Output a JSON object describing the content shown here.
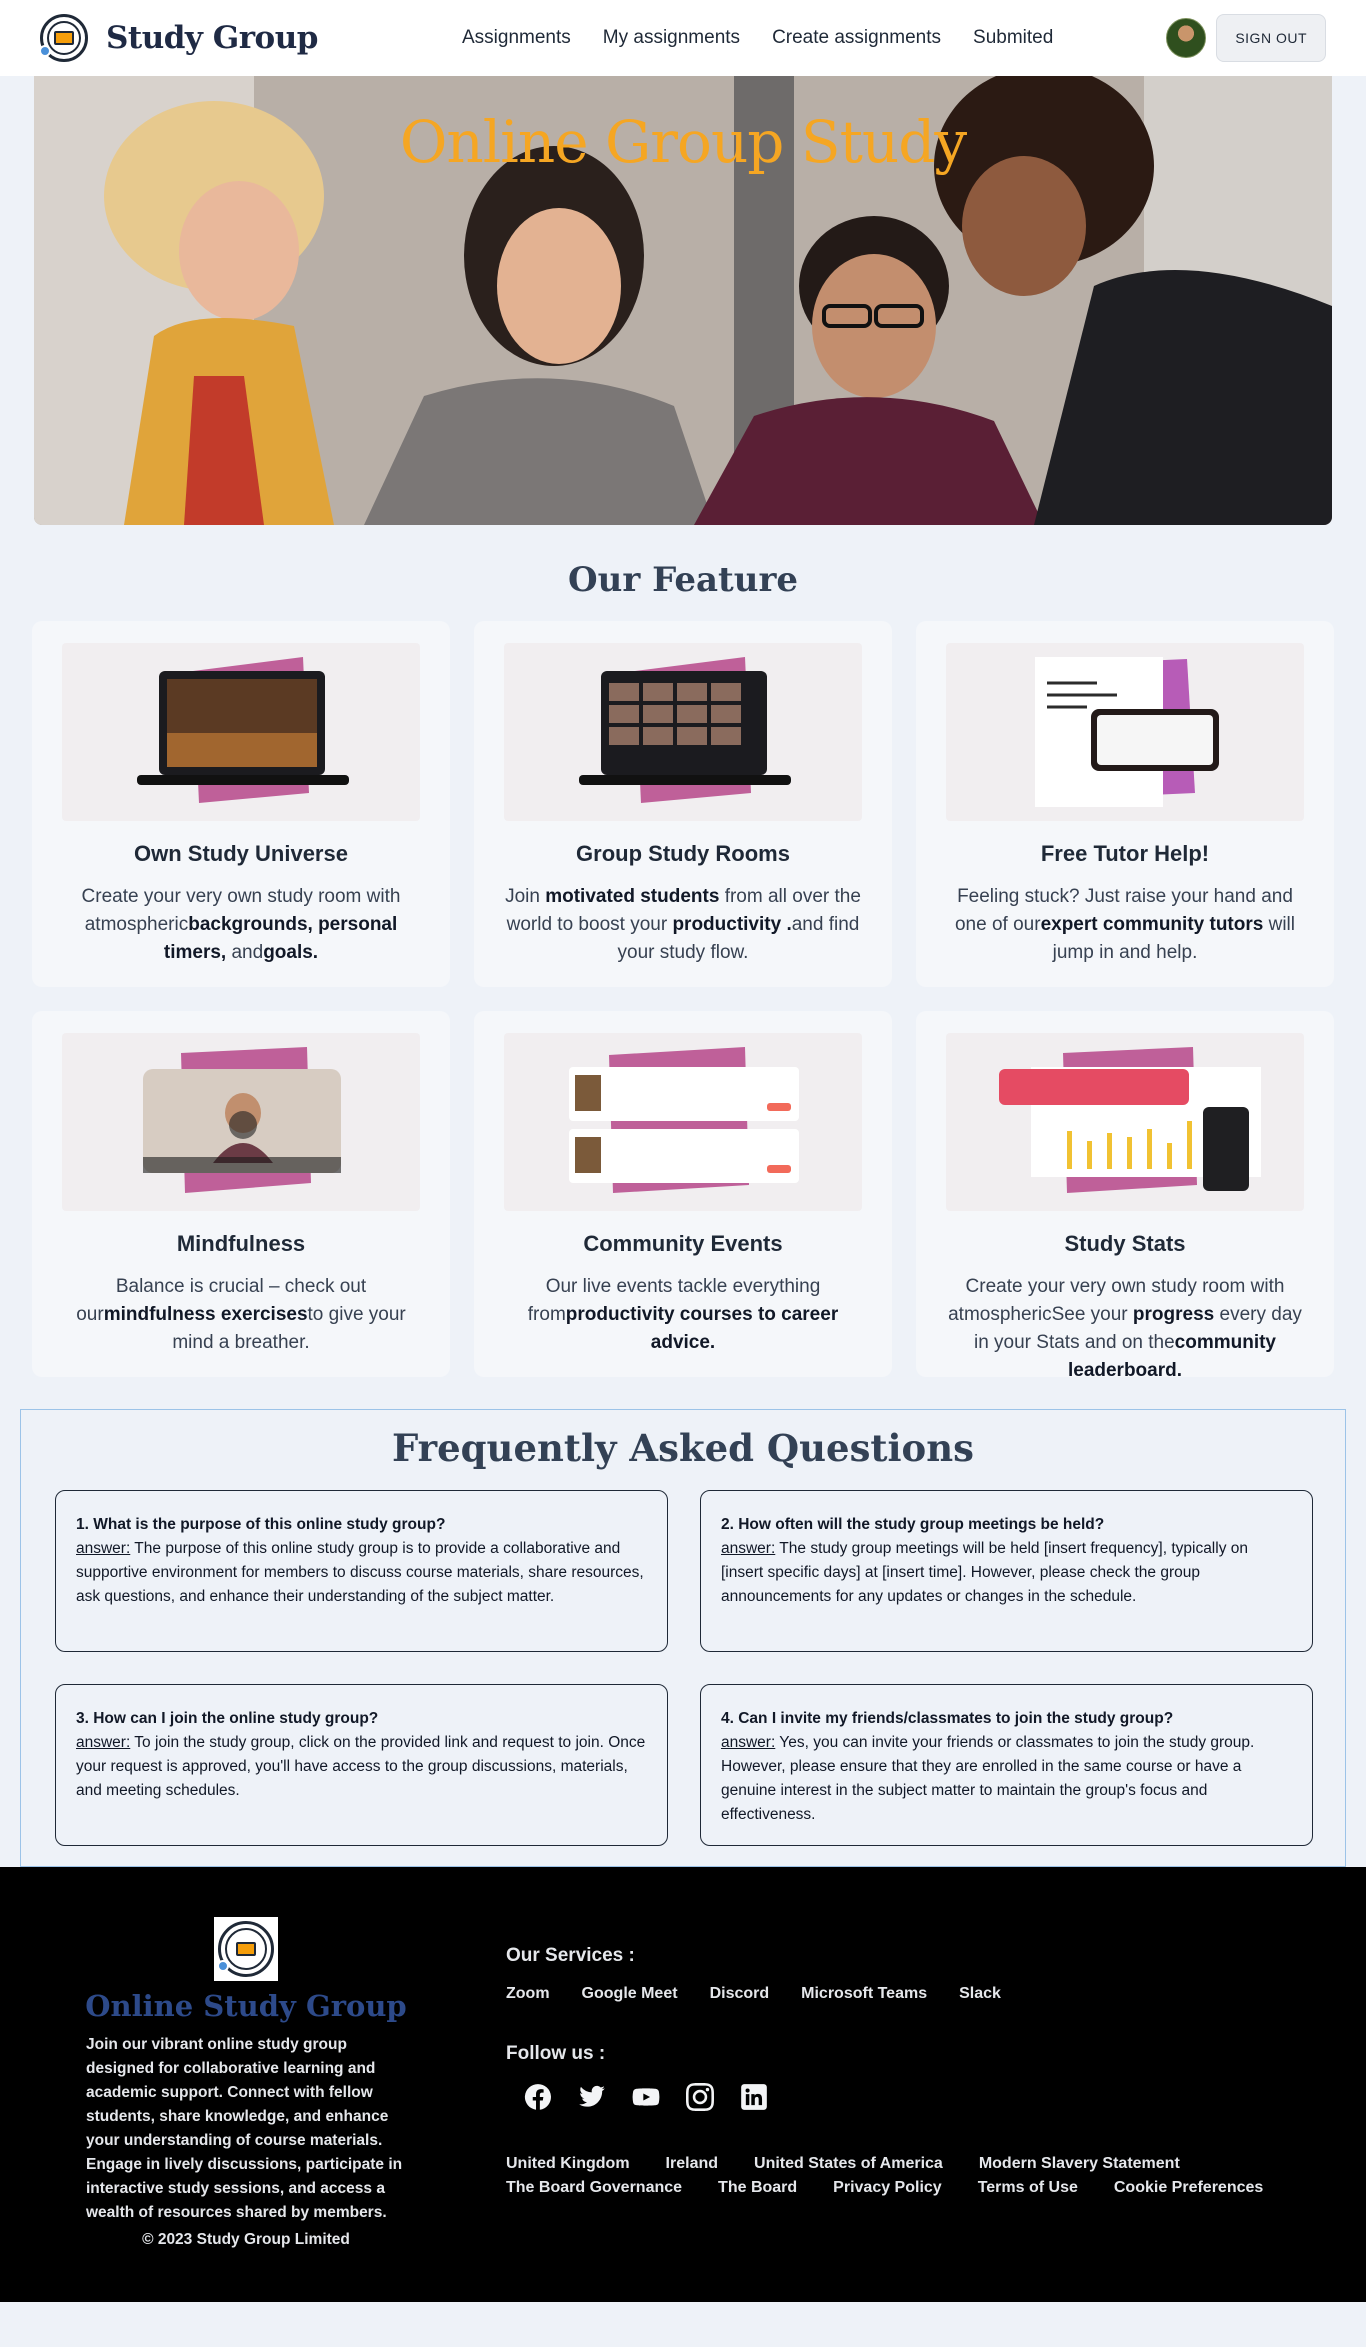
{
  "nav": {
    "brand": "Study Group",
    "links": [
      "Assignments",
      "My assignments",
      "Create assignments",
      "Submited"
    ],
    "sign_out": "SIGN OUT"
  },
  "hero": {
    "title": "Online Group Study"
  },
  "features": {
    "title": "Our Feature",
    "cards": [
      {
        "title": "Own Study Universe",
        "icon": "laptop-study-room-icon",
        "parts": [
          [
            "Create your very own study room with atmospheric",
            false
          ],
          [
            "backgrounds, personal timers,",
            true
          ],
          [
            " and",
            false
          ],
          [
            "goals.",
            true
          ]
        ]
      },
      {
        "title": "Group Study Rooms",
        "icon": "laptop-video-grid-icon",
        "parts": [
          [
            "Join ",
            false
          ],
          [
            "motivated students",
            true
          ],
          [
            " from all over the world to boost your ",
            false
          ],
          [
            "productivity .",
            true
          ],
          [
            "and find your study flow.",
            false
          ]
        ]
      },
      {
        "title": "Free Tutor Help!",
        "icon": "tutor-chat-icon",
        "parts": [
          [
            "Feeling stuck? Just raise your hand and one of our",
            false
          ],
          [
            "expert community tutors",
            true
          ],
          [
            " will jump in and help.",
            false
          ]
        ]
      },
      {
        "title": "Mindfulness",
        "icon": "meditation-video-icon",
        "parts": [
          [
            "Balance is crucial – check out our",
            false
          ],
          [
            "mindfulness exercises",
            true
          ],
          [
            "to give your mind a breather.",
            false
          ]
        ]
      },
      {
        "title": "Community Events",
        "icon": "event-list-icon",
        "parts": [
          [
            "Our live events tackle everything from",
            false
          ],
          [
            "productivity courses to career advice.",
            true
          ]
        ]
      },
      {
        "title": "Study Stats",
        "icon": "stats-chart-icon",
        "parts": [
          [
            "Create your very own study room with atmosphericSee your ",
            false
          ],
          [
            "progress",
            true
          ],
          [
            " every day in your Stats and on the",
            false
          ],
          [
            "community leaderboard.",
            true
          ]
        ]
      }
    ]
  },
  "faq": {
    "title": "Frequently Asked Questions",
    "answer_label": "answer:",
    "items": [
      {
        "q": "1. What is the purpose of this online study group?",
        "a": " The purpose of this online study group is to provide a collaborative and supportive environment for members to discuss course materials, share resources, ask questions, and enhance their understanding of the subject matter."
      },
      {
        "q": "2. How often will the study group meetings be held?",
        "a": " The study group meetings will be held [insert frequency], typically on [insert specific days] at [insert time]. However, please check the group announcements for any updates or changes in the schedule."
      },
      {
        "q": "3. How can I join the online study group?",
        "a": " To join the study group, click on the provided link and request to join. Once your request is approved, you'll have access to the group discussions, materials, and meeting schedules."
      },
      {
        "q": "4. Can I invite my friends/classmates to join the study group?",
        "a": " Yes, you can invite your friends or classmates to join the study group. However, please ensure that they are enrolled in the same course or have a genuine interest in the subject matter to maintain the group's focus and effectiveness."
      }
    ]
  },
  "footer": {
    "title": "Online Study Group",
    "description": "Join our vibrant online study group designed for collaborative learning and academic support. Connect with fellow students, share knowledge, and enhance your understanding of course materials. Engage in lively discussions, participate in interactive study sessions, and access a wealth of resources shared by members.",
    "copyright": "© 2023 Study Group Limited",
    "services_title": "Our Services :",
    "services": [
      "Zoom",
      "Google Meet",
      "Discord",
      "Microsoft Teams",
      "Slack"
    ],
    "follow_title": "Follow us :",
    "social": [
      "facebook-icon",
      "twitter-icon",
      "youtube-icon",
      "instagram-icon",
      "linkedin-icon"
    ],
    "links": [
      "United Kingdom",
      "Ireland",
      "United States of America",
      "Modern Slavery Statement",
      "The Board Governance",
      "The Board",
      "Privacy Policy",
      "Terms of Use",
      "Cookie Preferences"
    ]
  },
  "colors": {
    "accent": "#f5a623",
    "brand_navy": "#1f2a44",
    "footer_title": "#2d4a8a",
    "card_gradient_a": "#c2418a",
    "card_gradient_b": "#8e56c2"
  }
}
